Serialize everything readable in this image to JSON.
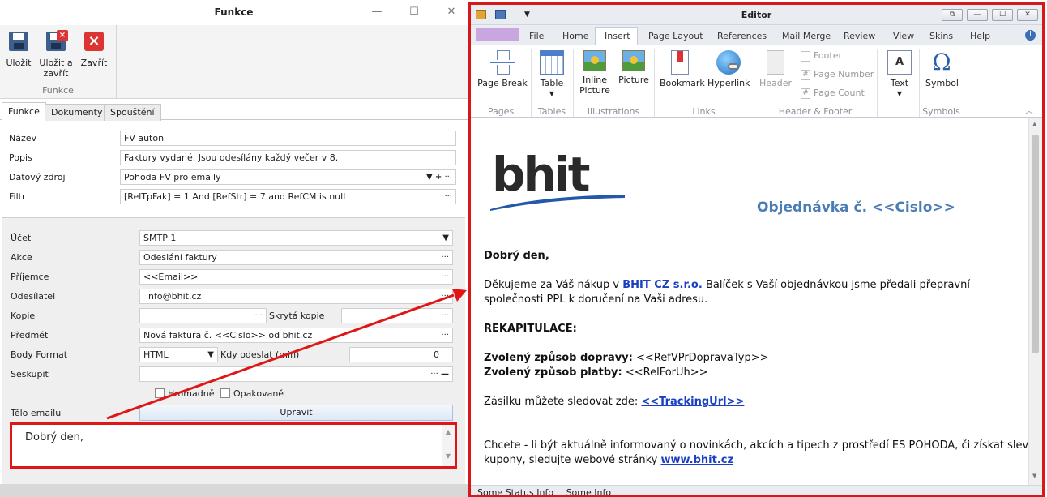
{
  "left": {
    "title": "Funkce",
    "ribbon": {
      "save": "Uložit",
      "save_close_1": "Uložit a",
      "save_close_2": "zavřít",
      "close": "Zavřít",
      "group": "Funkce"
    },
    "tabs": [
      "Funkce",
      "Dokumenty",
      "Spouštění"
    ],
    "fields": {
      "nazev": {
        "label": "Název",
        "value": "FV auton"
      },
      "popis": {
        "label": "Popis",
        "value": "Faktury vydané. Jsou odesílány každý večer v 8."
      },
      "zdroj": {
        "label": "Datový zdroj",
        "value": "Pohoda FV pro emaily"
      },
      "filtr": {
        "label": "Filtr",
        "value": "[RelTpFak] = 1 And [RefStr] = 7 and RefCM is null"
      },
      "ucet": {
        "label": "Účet",
        "value": "SMTP 1"
      },
      "akce": {
        "label": "Akce",
        "value": "Odeslání faktury"
      },
      "prijemce": {
        "label": "Příjemce",
        "value": "<<Email>>"
      },
      "odesilatel": {
        "label": "Odesílatel",
        "value": "info@bhit.cz"
      },
      "kopie": {
        "label": "Kopie",
        "value": ""
      },
      "skryta": {
        "label": "Skrytá kopie",
        "value": ""
      },
      "predmet": {
        "label": "Předmět",
        "value": "Nová faktura č. <<Cislo>> od bhit.cz"
      },
      "bodyformat": {
        "label": "Body Format",
        "value": "HTML"
      },
      "kdy": {
        "label": "Kdy odeslat (min)",
        "value": "0"
      },
      "seskupit": {
        "label": "Seskupit",
        "value": ""
      }
    },
    "hromadne": "Hromadně",
    "opakovane": "Opakovaně",
    "telo_label": "Tělo emailu",
    "upravit": "Upravit",
    "body_preview": "Dobrý den,"
  },
  "right": {
    "title": "Editor",
    "menu": [
      "File",
      "Home",
      "Insert",
      "Page Layout",
      "References",
      "Mail Merge",
      "Review",
      "View",
      "Skins",
      "Help"
    ],
    "ribbon": {
      "page_break": "Page Break",
      "table": "Table",
      "inline_picture_1": "Inline",
      "inline_picture_2": "Picture",
      "picture": "Picture",
      "bookmark": "Bookmark",
      "hyperlink": "Hyperlink",
      "header": "Header",
      "footer": "Footer",
      "page_number": "Page Number",
      "page_count": "Page Count",
      "text": "Text",
      "symbol": "Symbol"
    },
    "groups": [
      "Pages",
      "Tables",
      "Illustrations",
      "Links",
      "Header & Footer",
      "Symbols"
    ],
    "doc": {
      "logo": "bhit",
      "heading": "Objednávka č. <<Cislo>>",
      "greeting": "Dobrý den,",
      "line1_a": "Děkujeme za Váš nákup v ",
      "line1_link": "BHIT CZ s.r.o.",
      "line1_b": " Balíček s Vaší objednávkou jsme předali přepravní",
      "line2": "společnosti  PPL k doručení na Vaši adresu.",
      "recap": "REKAPITULACE:",
      "doprava_label": "Zvolený způsob dopravy:",
      "doprava_value": " <<RefVPrDopravaTyp>>",
      "platba_label": "Zvolený způsob platby:",
      "platba_value": " <<RelForUh>>",
      "track_a": "Zásilku můžete sledovat zde: ",
      "track_link": "<<TrackingUrl>>",
      "promo1": "Chcete - li být aktuálně informovaný o novinkách, akcích a tipech z prostředí ES POHODA, či získat slevové",
      "promo2_a": "kupony, sledujte webové stránky ",
      "promo2_link": "www.bhit.cz"
    },
    "status": [
      "Some Status Info",
      "Some Info"
    ]
  },
  "colors": {
    "annotation": "#e01515",
    "heading": "#4a7db5",
    "link": "#1a3fc2"
  }
}
